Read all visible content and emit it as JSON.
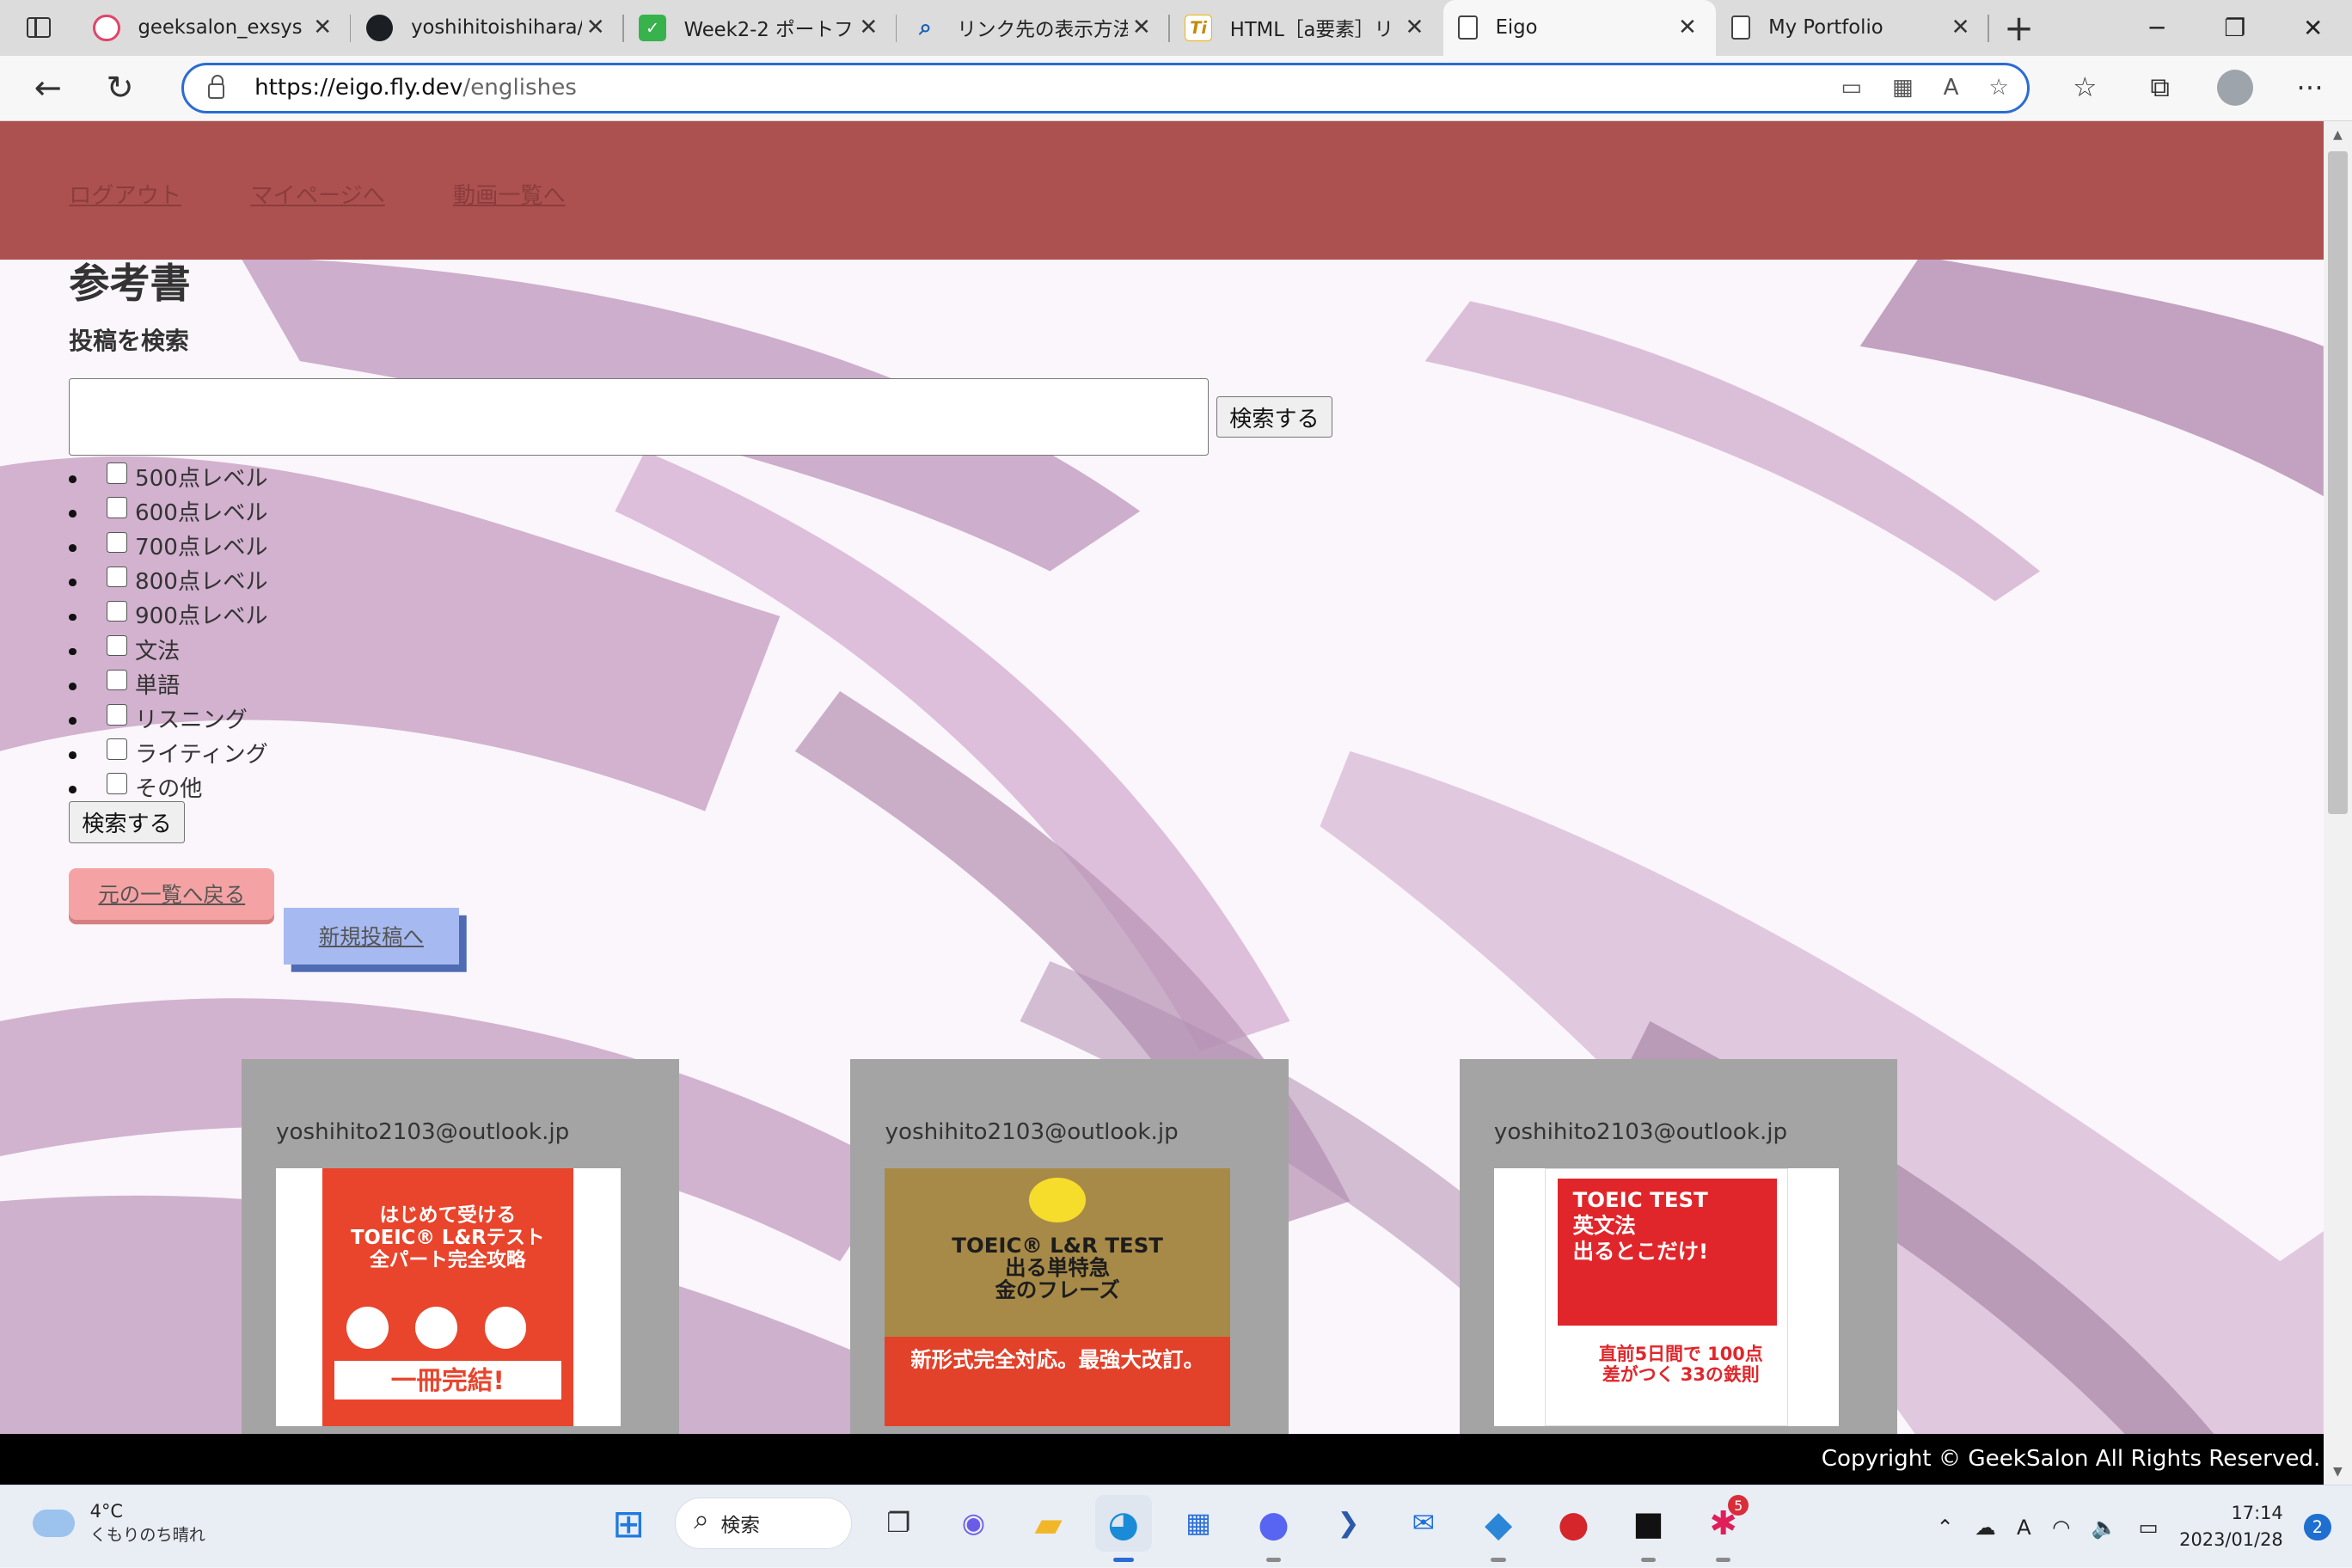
{
  "browser": {
    "tabs": [
      {
        "title": "geeksalon_exsys",
        "icon": "geeksalon-icon",
        "color": "#e0456b"
      },
      {
        "title": "yoshihitoishihara/",
        "icon": "github-icon",
        "color": "#1b1f23"
      },
      {
        "title": "Week2-2 ポートフォ",
        "icon": "check-icon",
        "color": "#37b24d"
      },
      {
        "title": "リンク先の表示方法",
        "icon": "search-icon",
        "color": "#1a5fb4"
      },
      {
        "title": "HTML［a要素］リ",
        "icon": "ti-icon",
        "color": "#f0b400"
      },
      {
        "title": "Eigo",
        "icon": "page-icon",
        "color": "#ffffff"
      },
      {
        "title": "My Portfolio",
        "icon": "page-icon",
        "color": "#ffffff"
      }
    ],
    "url_host": "https://eigo.fly.dev",
    "url_path": "/englishes"
  },
  "header": {
    "nav": [
      "ログアウト",
      "マイページへ",
      "動画一覧へ"
    ]
  },
  "page": {
    "title": "参考書",
    "search_label": "投稿を検索",
    "search_value": "",
    "search_button": "検索する",
    "filters": [
      "500点レベル",
      "600点レベル",
      "700点レベル",
      "800点レベル",
      "900点レベル",
      "文法",
      "単語",
      "リスニング",
      "ライティング",
      "その他"
    ],
    "submit_button": "検索する",
    "back_button": "元の一覧へ戻る",
    "new_post_button": "新規投稿へ"
  },
  "posts": [
    {
      "email": "yoshihito2103@outlook.jp",
      "cover": {
        "lines": [
          "はじめて受ける",
          "TOEIC® L&Rテスト",
          "全パート完全攻略"
        ],
        "band": "一冊完結!",
        "color": "#e8452c"
      }
    },
    {
      "email": "yoshihito2103@outlook.jp",
      "cover": {
        "lines": [
          "TOEIC® L&R TEST",
          "出る単特急",
          "金のフレーズ"
        ],
        "band": "新形式完全対応。最強大改訂。",
        "color": "#a88a48"
      }
    },
    {
      "email": "yoshihito2103@outlook.jp",
      "cover": {
        "lines": [
          "TOEIC TEST",
          "英文法",
          "出るとこだけ!"
        ],
        "band": "直前5日間で 100点差がつく 33の鉄則",
        "color": "#e0262b"
      }
    }
  ],
  "footer": {
    "text": "Copyright © GeekSalon All Rights Reserved."
  },
  "taskbar": {
    "weather_temp": "4°C",
    "weather_desc": "くもりのち晴れ",
    "search_label": "検索",
    "time": "17:14",
    "date": "2023/01/28",
    "notification_count": "2",
    "slack_badge": "5"
  },
  "colors": {
    "header_bg": "#ad5150",
    "card_bg": "#a4a4a4",
    "back_button_bg": "#f4a2a3",
    "new_button_bg": "#a6b9f0"
  }
}
